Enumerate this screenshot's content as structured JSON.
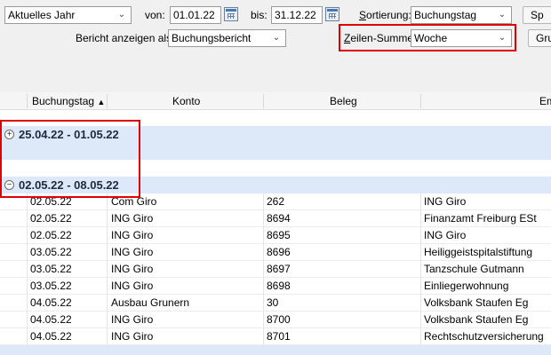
{
  "filters": {
    "period_value": "Aktuelles Jahr",
    "from_label": "von:",
    "from_value": "01.01.22",
    "to_label": "bis:",
    "to_value": "31.12.22",
    "sort_label": "Sortierung:",
    "sort_value": "Buchungstag",
    "report_label": "Bericht anzeigen als:",
    "report_value": "Buchungsbericht",
    "rowsum_label": "Zeilen-Summe:",
    "rowsum_value": "Woche",
    "btn1_label": "Sp",
    "btn2_label": "Gru"
  },
  "table": {
    "columns": [
      "Buchungstag",
      "Konto",
      "Beleg",
      "Em"
    ],
    "groups": [
      {
        "label": "25.04.22 - 01.05.22",
        "state": "collapsed"
      },
      {
        "label": "02.05.22 - 08.05.22",
        "state": "expanded"
      }
    ],
    "rows": [
      [
        "02.05.22",
        "Com Giro",
        "262",
        "ING Giro"
      ],
      [
        "02.05.22",
        "ING Giro",
        "8694",
        "Finanzamt Freiburg ESt"
      ],
      [
        "02.05.22",
        "ING Giro",
        "8695",
        "ING Giro"
      ],
      [
        "03.05.22",
        "ING Giro",
        "8696",
        "Heiliggeistspitalstiftung"
      ],
      [
        "03.05.22",
        "ING Giro",
        "8697",
        "Tanzschule Gutmann"
      ],
      [
        "03.05.22",
        "ING Giro",
        "8698",
        "Einliegerwohnung"
      ],
      [
        "04.05.22",
        "Ausbau Grunern",
        "30",
        "Volksbank Staufen Eg"
      ],
      [
        "04.05.22",
        "ING Giro",
        "8700",
        "Volksbank Staufen Eg"
      ],
      [
        "04.05.22",
        "ING Giro",
        "8701",
        "Rechtschutzversicherung"
      ]
    ]
  },
  "icons": {
    "dropdown": "chevron-down-icon",
    "calendar": "calendar-icon",
    "expand": "plus-circle-icon",
    "collapse": "minus-circle-icon",
    "sort": "sort-ascending-icon"
  },
  "colors": {
    "highlight": "#e00000",
    "group_row": "#dde9f8"
  }
}
